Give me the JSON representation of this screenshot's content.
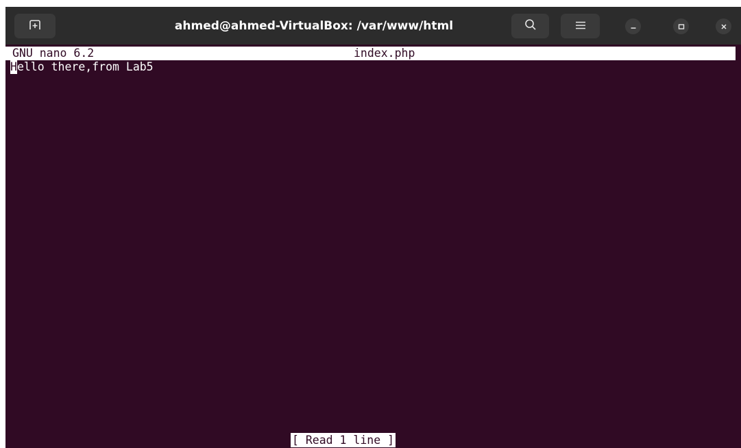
{
  "window": {
    "title": "ahmed@ahmed-VirtualBox: /var/www/html"
  },
  "titlebar_icons": {
    "new_tab": "new-tab-icon",
    "search": "search-icon",
    "menu": "hamburger-menu-icon",
    "minimize": "minimize-icon",
    "maximize": "maximize-icon",
    "close": "close-icon"
  },
  "nano": {
    "version": "GNU nano 6.2",
    "filename": "index.php",
    "cursor_char": "H",
    "line_rest": "ello there,from Lab5",
    "status": "[ Read 1 line ]"
  },
  "colors": {
    "terminal_bg": "#300a24",
    "titlebar_bg": "#2c2c2c",
    "text": "#ffffff"
  }
}
